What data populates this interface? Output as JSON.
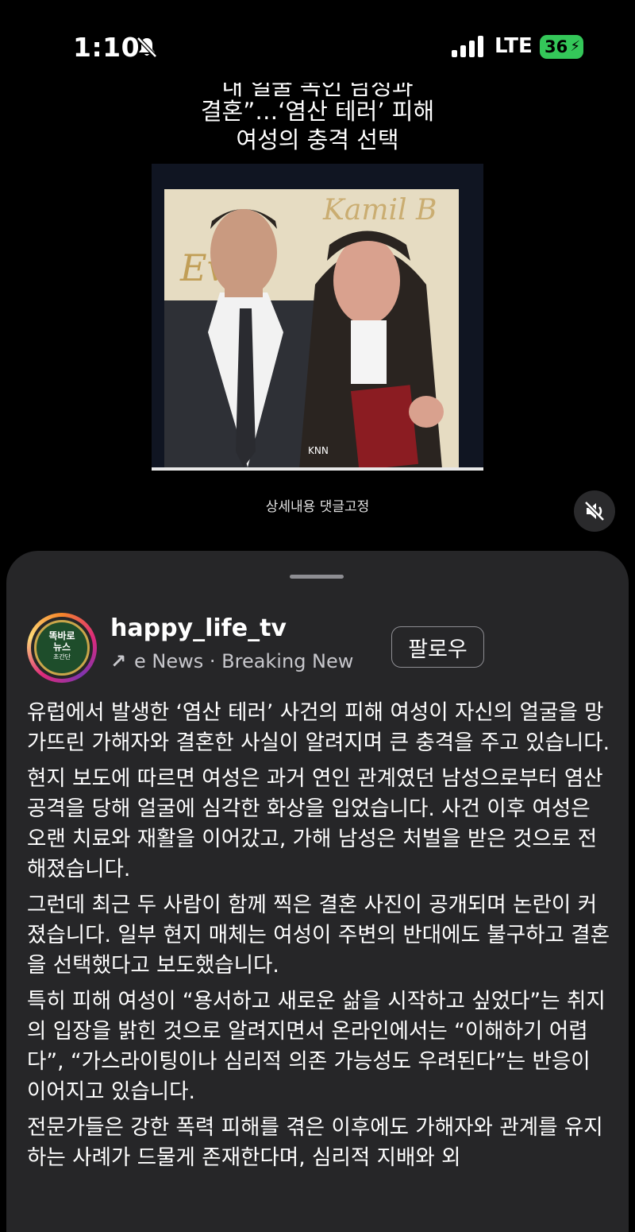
{
  "status_bar": {
    "time": "1:10",
    "network": "LTE",
    "battery": "36"
  },
  "video": {
    "caption_lines": [
      "내 얼굴 녹인 남성과",
      "결혼”…‘염산 테러’ 피해",
      "여성의 충격 선택"
    ],
    "watermark": "KNN",
    "subtitle": "상세내용 댓글고정"
  },
  "post": {
    "username": "happy_life_tv",
    "subline": "e News · Breaking New",
    "follow_label": "팔로우",
    "avatar_text": [
      "똑바로",
      "뉴스",
      "초간단"
    ],
    "paragraphs": [
      "유럽에서 발생한 ‘염산 테러’ 사건의 피해 여성이 자신의 얼굴을 망가뜨린 가해자와 결혼한 사실이 알려지며 큰 충격을 주고 있습니다.",
      "현지 보도에 따르면 여성은 과거 연인 관계였던 남성으로부터 염산 공격을 당해 얼굴에 심각한 화상을 입었습니다. 사건 이후 여성은 오랜 치료와 재활을 이어갔고, 가해 남성은 처벌을 받은 것으로 전해졌습니다.",
      "그런데 최근 두 사람이 함께 찍은 결혼 사진이 공개되며 논란이 커졌습니다. 일부 현지 매체는 여성이 주변의 반대에도 불구하고 결혼을 선택했다고 보도했습니다.",
      "특히 피해 여성이 “용서하고 새로운 삶을 시작하고 싶었다”는 취지의 입장을 밝힌 것으로 알려지면서 온라인에서는 “이해하기 어렵다”, “가스라이팅이나 심리적 의존 가능성도 우려된다”는 반응이 이어지고 있습니다.",
      "전문가들은 강한 폭력 피해를 겪은 이후에도 가해자와 관계를 유지하는 사례가 드물게 존재한다며, 심리적 지배와 외"
    ]
  }
}
